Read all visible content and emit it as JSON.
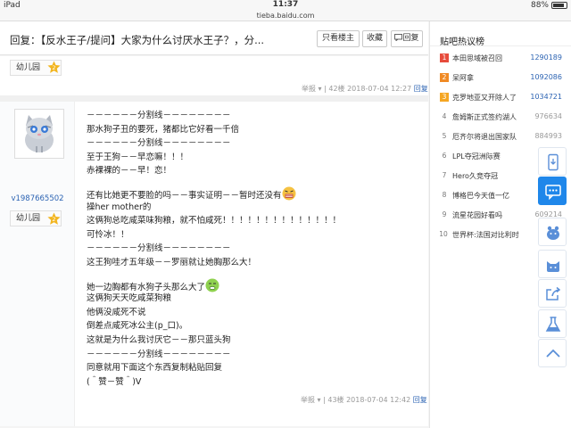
{
  "status": {
    "device": "iPad",
    "time": "11:37",
    "battery": "88%",
    "url": "tieba.baidu.com"
  },
  "header": {
    "title": "回复：【反水王子/提问】大家为什么讨厌水王子？，分...",
    "buttons": {
      "only_op": "只看楼主",
      "favorite": "收藏",
      "reply": "回复"
    }
  },
  "prev_post": {
    "level_name": "幼儿园",
    "level_num": "2",
    "report": "举报",
    "floor": "42楼",
    "time": "2018-07-04 12:27",
    "reply": "回复"
  },
  "post": {
    "username": "v1987665502",
    "level_name": "幼儿园",
    "level_num": "2",
    "lines": [
      "－－－－－－分割线－－－－－－－－",
      "那水狗子丑的要死，猪都比它好看一千倍",
      "－－－－－－分割线－－－－－－－－",
      "至于王狗－－早恋嘛！！！",
      "赤裸裸的－－早！恋！",
      "还有比她更不要脸的吗－－事实证明－－暂时还没有",
      "操her mother的",
      "这俩狗总吃咸菜味狗粮，就不怕咸死！！！！！！！！！！！！！！",
      "可怜冰！！",
      "－－－－－－分割线－－－－－－－－",
      "这王狗哇才五年级－－罗丽就让她胸那么大！",
      "她一边胸都有水狗子头那么大了",
      "这俩狗天天吃咸菜狗粮",
      "他俩没咸死不说",
      "倒差点咸死冰公主(p_口)。",
      "这就是为什么我讨厌它－－那只蓝头狗",
      "－－－－－－分割线－－－－－－－－",
      "同意就用下面这个东西复制粘贴回复",
      "(＾赞－赞＾)V"
    ]
  },
  "post_meta": {
    "report": "举报",
    "floor": "43楼",
    "time": "2018-07-04 12:42",
    "reply": "回复"
  },
  "sidebar": {
    "title": "贴吧热议榜",
    "items": [
      {
        "rank": "1",
        "title": "本田思域被召回",
        "count": "1290189"
      },
      {
        "rank": "2",
        "title": "呆阿拿",
        "count": "1092086"
      },
      {
        "rank": "3",
        "title": "克罗地亚又开除人了",
        "count": "1034721"
      },
      {
        "rank": "4",
        "title": "詹姆斯正式签约湖人",
        "count": "976634"
      },
      {
        "rank": "5",
        "title": "厄齐尔将退出国家队",
        "count": "884993"
      },
      {
        "rank": "6",
        "title": "LPL夺冠洲际赛",
        "count": ""
      },
      {
        "rank": "7",
        "title": "Hero久竞夺冠",
        "count": ""
      },
      {
        "rank": "8",
        "title": "博格巴今天值一亿",
        "count": ""
      },
      {
        "rank": "9",
        "title": "流星花园好看吗",
        "count": "609214"
      },
      {
        "rank": "10",
        "title": "世界杯:法国对比利时",
        "count": ""
      }
    ]
  },
  "colors": {
    "accent_blue": "#2d64b3",
    "rank1": "#e74c3c",
    "rank2": "#f08a24",
    "rank3": "#f5a623",
    "tool_active": "#1f87ea"
  },
  "icons": {
    "tools": [
      "phone-icon",
      "comment-icon",
      "tieba-icon",
      "cat-icon",
      "share-icon",
      "lab-icon",
      "chevron-up-icon"
    ]
  }
}
